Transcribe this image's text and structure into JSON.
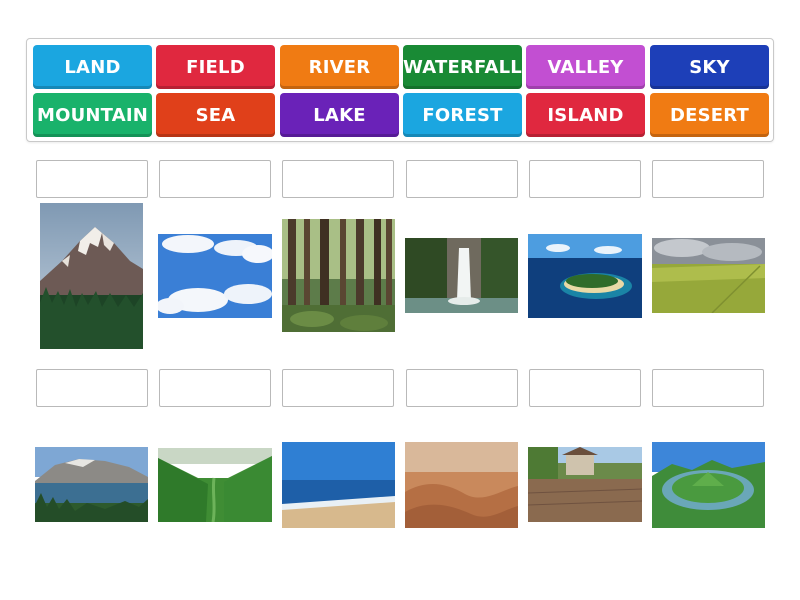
{
  "tiles": [
    {
      "label": "LAND",
      "color": "#1ba6e0"
    },
    {
      "label": "FIELD",
      "color": "#e0283f"
    },
    {
      "label": "RIVER",
      "color": "#f07b13"
    },
    {
      "label": "WATERFALL",
      "color": "#198a35"
    },
    {
      "label": "VALLEY",
      "color": "#c24fd2"
    },
    {
      "label": "SKY",
      "color": "#1d3fb8"
    },
    {
      "label": "MOUNTAIN",
      "color": "#19b26b"
    },
    {
      "label": "SEA",
      "color": "#e0401a"
    },
    {
      "label": "LAKE",
      "color": "#6a22b8"
    },
    {
      "label": "FOREST",
      "color": "#1ba6e0"
    },
    {
      "label": "ISLAND",
      "color": "#e0283f"
    },
    {
      "label": "DESERT",
      "color": "#f07b13"
    }
  ],
  "images_row1": [
    "mountain-photo",
    "sky-photo",
    "forest-photo",
    "waterfall-photo",
    "island-photo",
    "field-photo"
  ],
  "images_row2": [
    "lake-photo",
    "valley-photo",
    "sea-photo",
    "desert-photo",
    "land-photo",
    "river-photo"
  ]
}
